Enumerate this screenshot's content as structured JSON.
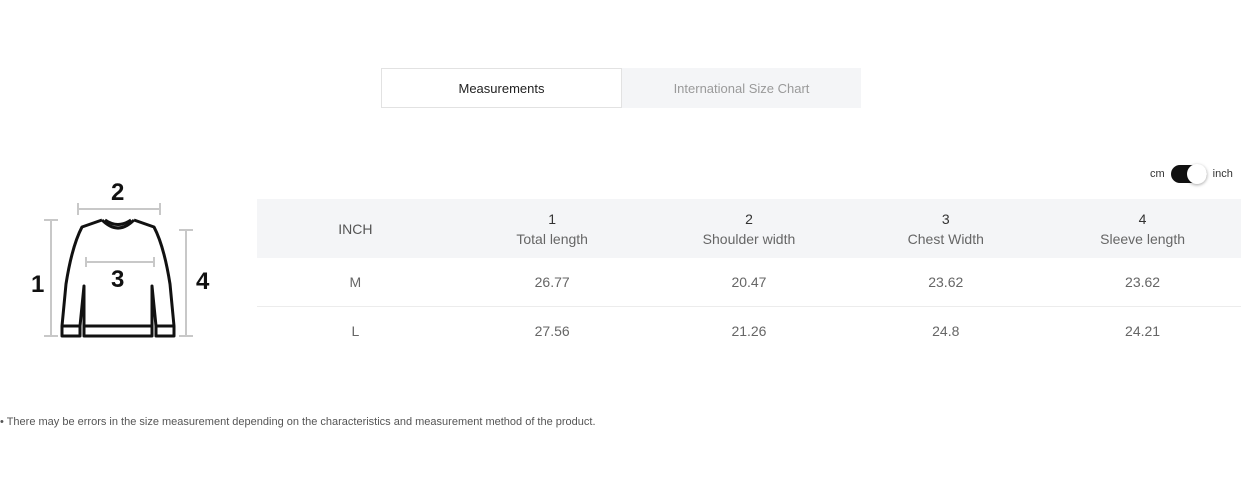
{
  "tabs": {
    "measurements": "Measurements",
    "international": "International Size Chart"
  },
  "unit_toggle": {
    "left_label": "cm",
    "right_label": "inch",
    "selected": "inch"
  },
  "diagram": {
    "labels": [
      "1",
      "2",
      "3",
      "4"
    ]
  },
  "table": {
    "unit_header": "INCH",
    "columns": [
      {
        "num": "1",
        "label": "Total length"
      },
      {
        "num": "2",
        "label": "Shoulder width"
      },
      {
        "num": "3",
        "label": "Chest Width"
      },
      {
        "num": "4",
        "label": "Sleeve length"
      }
    ],
    "rows": [
      {
        "size": "M",
        "values": [
          "26.77",
          "20.47",
          "23.62",
          "23.62"
        ]
      },
      {
        "size": "L",
        "values": [
          "27.56",
          "21.26",
          "24.8",
          "24.21"
        ]
      }
    ]
  },
  "note": "• There may be errors in the size measurement depending on the characteristics and measurement method of the product.",
  "colors": {
    "header_bg": "#f4f5f7",
    "toggle_on": "#111111"
  }
}
